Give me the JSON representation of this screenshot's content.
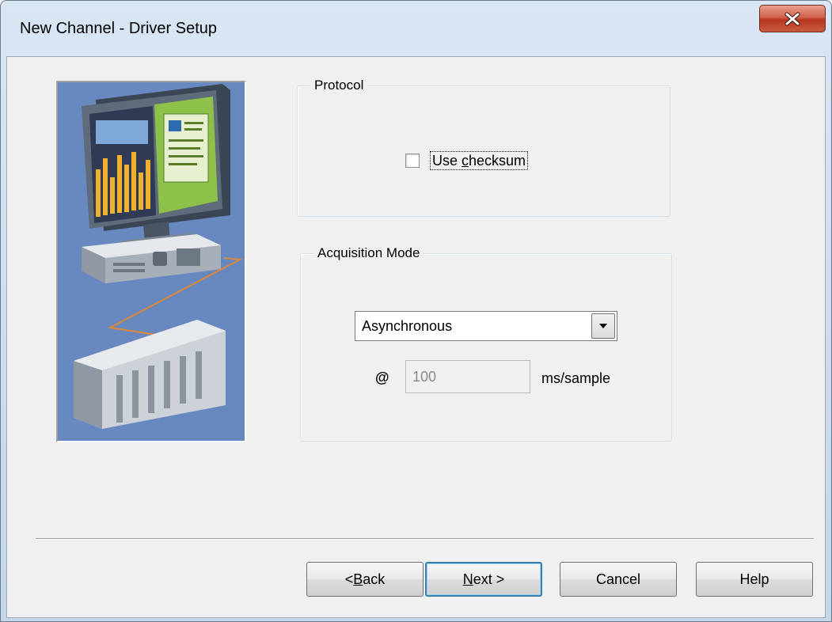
{
  "window": {
    "title": "New Channel - Driver Setup"
  },
  "protocol": {
    "group_label": "Protocol",
    "checksum_label_pre": "Use ",
    "checksum_label_accel": "c",
    "checksum_label_post": "hecksum",
    "checksum_checked": false
  },
  "acquisition": {
    "group_label": "Acquisition Mode",
    "mode_value": "Asynchronous",
    "at_label": "@",
    "rate_value": "100",
    "rate_unit": "ms/sample"
  },
  "buttons": {
    "back_pre": "< ",
    "back_accel": "B",
    "back_post": "ack",
    "next_accel": "N",
    "next_post": "ext >",
    "cancel": "Cancel",
    "help": "Help"
  },
  "icons": {
    "close": "close-icon",
    "dropdown": "chevron-down-icon",
    "hero": "computer-plc-illustration"
  },
  "colors": {
    "hero_background": "#6789bf",
    "default_button_border": "#3c7fb1",
    "close_button": "#c94a32"
  }
}
